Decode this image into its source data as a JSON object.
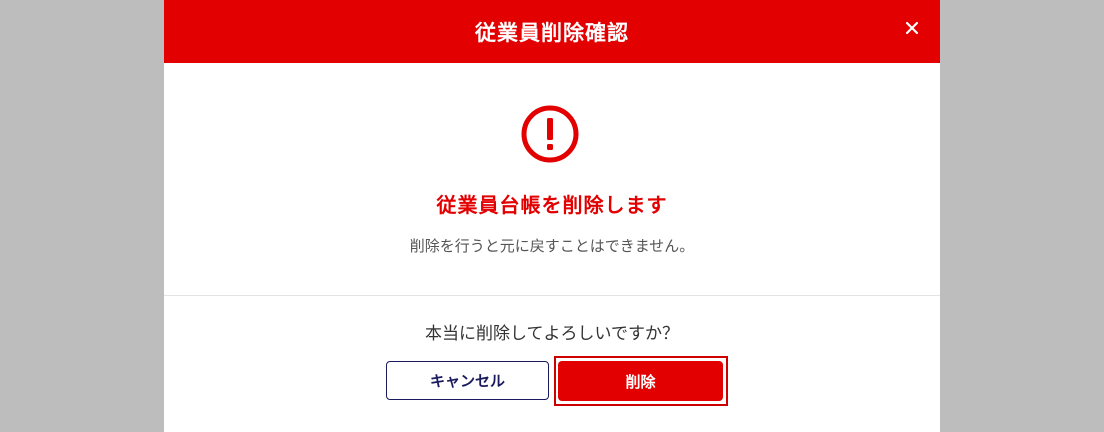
{
  "dialog": {
    "title": "従業員削除確認",
    "close_icon": "close-icon",
    "warning_icon": "exclamation-circle-icon",
    "message_title": "従業員台帳を削除します",
    "message_sub": "削除を行うと元に戻すことはできません。",
    "confirm_question": "本当に削除してよろしいですか？",
    "cancel_label": "キャンセル",
    "delete_label": "削除"
  },
  "colors": {
    "accent": "#e20000",
    "backdrop": "#bdbdbd",
    "cancel_border": "#1a1a5e"
  }
}
